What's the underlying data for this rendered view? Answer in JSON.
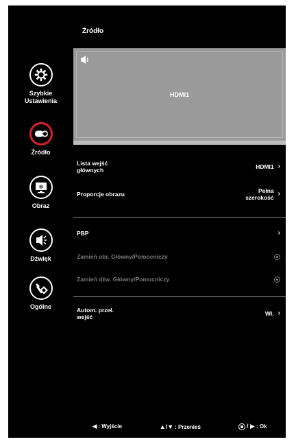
{
  "header": {
    "title": "Źródło"
  },
  "sidebar": {
    "items": [
      {
        "label": "Szybkie\nUstawienia",
        "icon": "gear-icon",
        "active": false
      },
      {
        "label": "Źródło",
        "icon": "input-source-icon",
        "active": true
      },
      {
        "label": "Obraz",
        "icon": "picture-icon",
        "active": false
      },
      {
        "label": "Dźwięk",
        "icon": "speaker-icon",
        "active": false
      },
      {
        "label": "Ogólne",
        "icon": "settings-tools-icon",
        "active": false
      }
    ]
  },
  "preview": {
    "title": "HDMI1",
    "icon": "speaker-small-icon"
  },
  "rows": [
    {
      "label": "Lista wejść\ngłównych",
      "value": "HDMI1",
      "control": "chevron"
    },
    {
      "label": "Proporcje obrazu",
      "value": "Pełna\nszerokość",
      "control": "chevron"
    },
    {
      "label": "PBP",
      "value": "",
      "control": "chevron"
    },
    {
      "label": "Zamień obr. Główny/Pomocniczy",
      "value": "",
      "control": "radio",
      "disabled": true
    },
    {
      "label": "Zamień dźw. Główny/Pomocniczy",
      "value": "",
      "control": "radio",
      "disabled": true
    },
    {
      "label": "Autom. przeł.\nwejść",
      "value": "Wł.",
      "control": "chevron"
    }
  ],
  "footer": {
    "exit": ": Wyjście",
    "move": ": Przenieś",
    "ok": ": Ok",
    "move_keys": "▲/▼",
    "ok_keys": "/ ▶",
    "exit_key": "◀"
  },
  "colors": {
    "background": "#000000",
    "accent": "#e02030",
    "preview": "#9a9a9a",
    "disabled_text": "#7a7a7a"
  }
}
